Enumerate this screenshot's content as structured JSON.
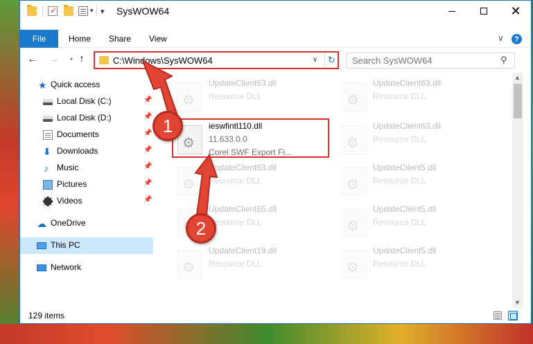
{
  "window": {
    "title": "SysWOW64",
    "minimize_icon": "minimize-icon",
    "maximize_icon": "maximize-icon",
    "close_glyph": "✕"
  },
  "quick_access_toolbar": {
    "dropdown_glyph": "▾"
  },
  "ribbon": {
    "tabs": [
      {
        "label": "File"
      },
      {
        "label": "Home"
      },
      {
        "label": "Share"
      },
      {
        "label": "View"
      }
    ],
    "help_glyph": "?",
    "chevron_glyph": "∨"
  },
  "nav": {
    "back_glyph": "←",
    "forward_glyph": "→",
    "recent_glyph": "▾",
    "up_glyph": "↑",
    "address": "C:\\Windows\\SysWOW64",
    "address_dropdown_glyph": "∨",
    "refresh_glyph": "↻",
    "search_placeholder": "Search SysWOW64",
    "search_glyph": "⚲"
  },
  "sidebar": {
    "pin_glyph": "📌",
    "items": [
      {
        "label": "Quick access",
        "icon": "star-icon",
        "pinned": false
      },
      {
        "label": "Local Disk (C:)",
        "icon": "drive-icon",
        "pinned": true
      },
      {
        "label": "Local Disk (D:)",
        "icon": "drive-icon",
        "pinned": true
      },
      {
        "label": "Documents",
        "icon": "documents-icon",
        "pinned": true
      },
      {
        "label": "Downloads",
        "icon": "download-icon",
        "pinned": true
      },
      {
        "label": "Music",
        "icon": "music-icon",
        "pinned": true
      },
      {
        "label": "Pictures",
        "icon": "pictures-icon",
        "pinned": true
      },
      {
        "label": "Videos",
        "icon": "videos-icon",
        "pinned": true
      },
      {
        "label": "OneDrive",
        "icon": "cloud-icon",
        "pinned": false
      },
      {
        "label": "This PC",
        "icon": "computer-icon",
        "pinned": false,
        "selected": true
      },
      {
        "label": "Network",
        "icon": "network-icon",
        "pinned": false
      }
    ],
    "glyphs": {
      "star": "★",
      "download": "⬇",
      "music": "♪",
      "cloud": "☁"
    }
  },
  "files": [
    {
      "name": "UpdateClient63.dll",
      "type": "Resource DLL",
      "faded": true
    },
    {
      "name": "UpdateClient63.dll",
      "type": "Resource DLL",
      "faded": true
    },
    {
      "name": "ieswfintl110.dll",
      "version": "11.633.0.0",
      "description": "Corel SWF Export Fi...",
      "faded": false,
      "highlighted": true
    },
    {
      "name": "UpdateClient63.dll",
      "type": "Resource DLL",
      "faded": true
    },
    {
      "name": "UpdateClient63.dll",
      "type": "Resource DLL",
      "faded": true
    },
    {
      "name": "UpdateClient5.dll",
      "type": "Resource DLL",
      "faded": true
    },
    {
      "name": "UpdateClient65.dll",
      "type": "Resource DLL",
      "faded": true
    },
    {
      "name": "UpdateClient5.dll",
      "type": "Resource DLL",
      "faded": true
    },
    {
      "name": "UpdateClient19.dll",
      "type": "Resource DLL",
      "faded": true
    },
    {
      "name": "UpdateClient5.dll",
      "type": "Resource DLL",
      "faded": true
    }
  ],
  "scrollbar": {
    "up_glyph": "▲",
    "down_glyph": "▼"
  },
  "status": {
    "item_count": "129 items"
  },
  "annotations": {
    "step1": "1",
    "step2": "2",
    "color": "#e24534"
  }
}
